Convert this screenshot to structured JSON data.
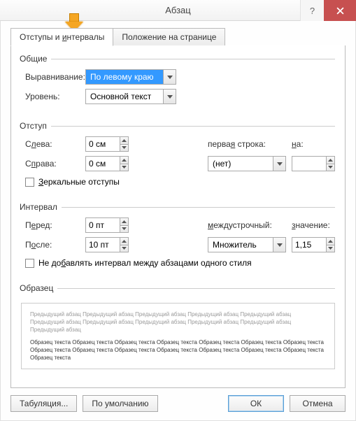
{
  "title": "Абзац",
  "tabs": {
    "t0": "Отступы и интервалы",
    "t1": "Положение на странице"
  },
  "general": {
    "legend": "Общие",
    "align_label": "Выравнивание:",
    "align_value": "По левому краю",
    "level_label": "Уровень:",
    "level_value": "Основной текст"
  },
  "indent": {
    "legend": "Отступ",
    "left_label": "Слева:",
    "left_value": "0 см",
    "right_label": "Справа:",
    "right_value": "0 см",
    "first_label": "первая строка:",
    "first_value": "(нет)",
    "by_label": "на:",
    "by_value": "",
    "mirror_label": "Зеркальные отступы"
  },
  "spacing": {
    "legend": "Интервал",
    "before_label": "Перед:",
    "before_value": "0 пт",
    "after_label": "После:",
    "after_value": "10 пт",
    "line_label": "междустрочный:",
    "line_value": "Множитель",
    "at_label": "значение:",
    "at_value": "1,15",
    "nospace_label": "Не добавлять интервал между абзацами одного стиля"
  },
  "preview": {
    "legend": "Образец",
    "gray1": "Предыдущий абзац Предыдущий абзац Предыдущий абзац Предыдущий абзац Предыдущий абзац Предыдущий абзац Предыдущий абзац Предыдущий абзац Предыдущий абзац Предыдущий абзац Предыдущий абзац",
    "dark1": "Образец текста Образец текста Образец текста Образец текста Образец текста Образец текста Образец текста Образец текста Образец текста Образец текста Образец текста Образец текста Образец текста Образец текста Образец текста"
  },
  "buttons": {
    "tabs": "Табуляция...",
    "default": "По умолчанию",
    "ok": "ОК",
    "cancel": "Отмена"
  }
}
